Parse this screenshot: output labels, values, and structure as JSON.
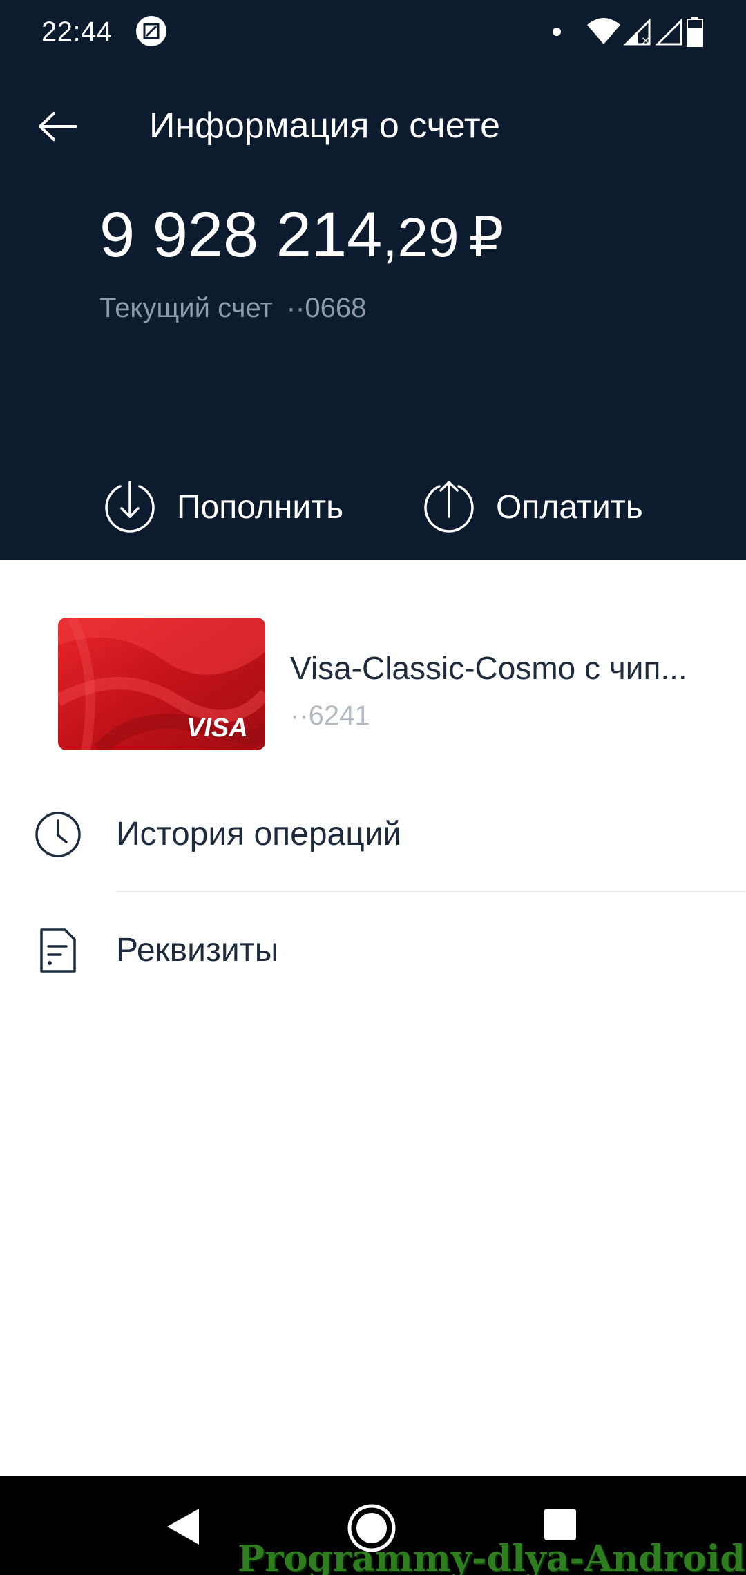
{
  "status_bar": {
    "time": "22:44"
  },
  "header": {
    "title": "Информация о счете",
    "balance": {
      "integer": "9 928 214",
      "fraction": ",29",
      "currency": "₽"
    },
    "account": {
      "label": "Текущий счет",
      "number": "··0668"
    },
    "actions": {
      "topup_label": "Пополнить",
      "pay_label": "Оплатить"
    }
  },
  "card": {
    "name": "Visa-Classic-Cosmo с чип...",
    "number": "··6241",
    "brand": "VISA",
    "color": "#d8161b"
  },
  "menu": {
    "history_label": "История операций",
    "details_label": "Реквизиты"
  },
  "watermark": "Programmy-dlya-Android.ru",
  "colors": {
    "header_bg": "#0d1b2e",
    "text_dark": "#1d2b3c",
    "text_muted": "#8e9aa8"
  }
}
